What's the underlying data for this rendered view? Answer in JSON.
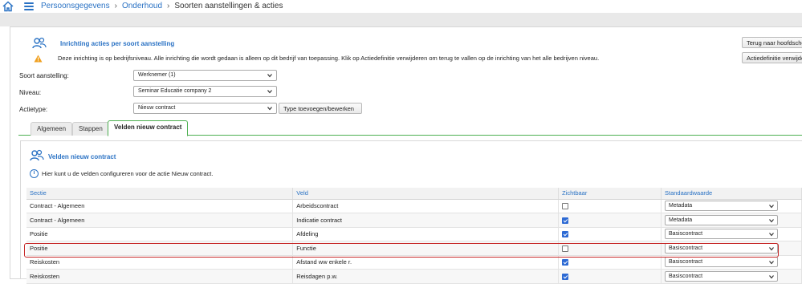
{
  "breadcrumb": {
    "items": [
      "Persoonsgegevens",
      "Onderhoud"
    ],
    "current": "Soorten aanstellingen & acties"
  },
  "panel": {
    "title": "Inrichting acties per soort aanstelling",
    "warning": "Deze inrichting is op bedrijfsniveau. Alle inrichting die wordt gedaan is alleen op dit bedrijf van toepassing. Klik op Actiedefinitie verwijderen om terug te vallen op de inrichting van het alle bedrijven niveau."
  },
  "buttons": {
    "back": "Terug naar hoofdscherm",
    "delete_def": "Actiedefinitie verwijderen",
    "type_edit": "Type toevoegen/bewerken"
  },
  "form": {
    "soort_label": "Soort aanstelling:",
    "soort_value": "Werknemer (1)",
    "niveau_label": "Niveau:",
    "niveau_value": "Seminar Educatie company 2",
    "actietype_label": "Actietype:",
    "actietype_value": "Nieuw contract"
  },
  "tabs": [
    "Algemeen",
    "Stappen",
    "Velden nieuw contract"
  ],
  "section": {
    "title": "Velden nieuw contract",
    "info": "Hier kunt u de velden configureren voor de actie Nieuw contract."
  },
  "table": {
    "headers": [
      "Sectie",
      "Veld",
      "Zichtbaar",
      "Standaardwaarde"
    ],
    "rows": [
      {
        "sectie": "Contract - Algemeen",
        "veld": "Arbeidscontract",
        "zichtbaar": false,
        "standaard": "Metadata"
      },
      {
        "sectie": "Contract - Algemeen",
        "veld": "Indicatie contract",
        "zichtbaar": true,
        "standaard": "Metadata"
      },
      {
        "sectie": "Positie",
        "veld": "Afdeling",
        "zichtbaar": true,
        "standaard": "Basiscontract"
      },
      {
        "sectie": "Positie",
        "veld": "Functie",
        "zichtbaar": false,
        "standaard": "Basiscontract"
      },
      {
        "sectie": "Reiskosten",
        "veld": "Afstand ww enkele r.",
        "zichtbaar": true,
        "standaard": "Basiscontract"
      },
      {
        "sectie": "Reiskosten",
        "veld": "Reisdagen p.w.",
        "zichtbaar": true,
        "standaard": "Basiscontract"
      }
    ]
  },
  "colors": {
    "accent": "#2a72c4",
    "tab_active_border": "#4caf50",
    "highlight": "#c62828",
    "checkbox_on": "#2d6ad4"
  },
  "icons": {
    "home": "home-icon",
    "menu": "hamburger-menu-icon",
    "users": "users-icon",
    "warning": "warning-icon",
    "info": "info-icon",
    "chevron": "chevron-down-icon"
  }
}
